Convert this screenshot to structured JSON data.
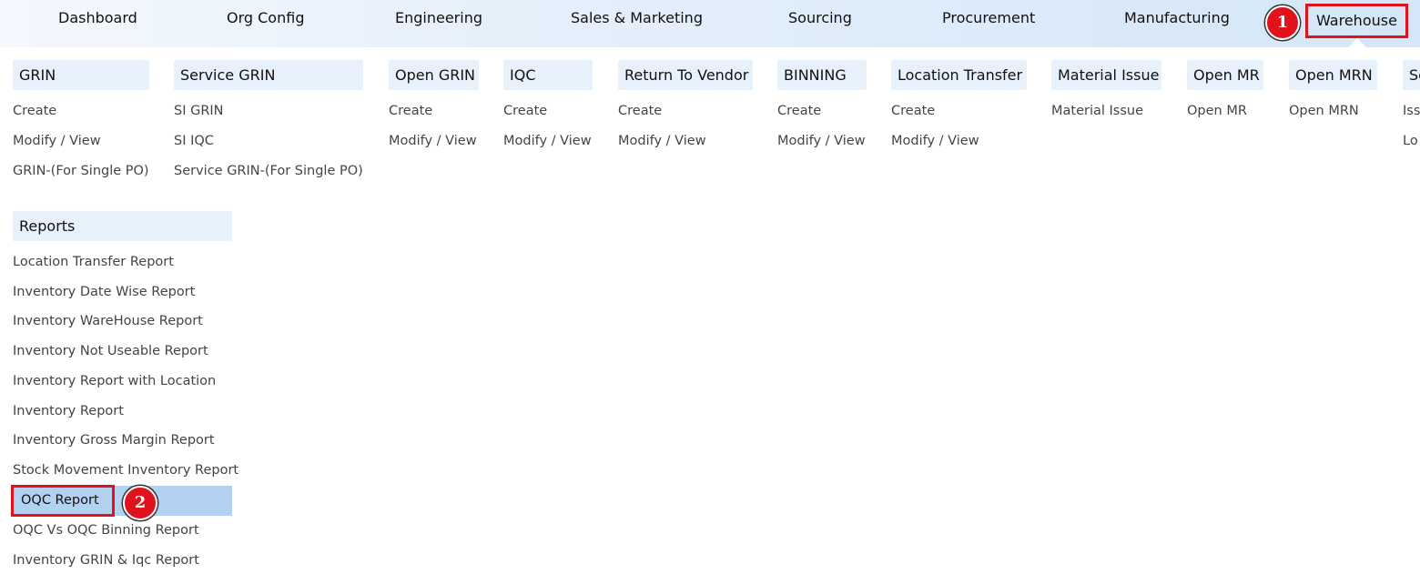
{
  "nav": {
    "items": [
      "Dashboard",
      "Org Config",
      "Engineering",
      "Sales & Marketing",
      "Sourcing",
      "Procurement",
      "Manufacturing"
    ],
    "active": "Warehouse"
  },
  "badges": {
    "one": "1",
    "two": "2"
  },
  "sections": [
    {
      "title": "GRIN",
      "links": [
        "Create",
        "Modify / View",
        "GRIN-(For Single PO)"
      ]
    },
    {
      "title": "Service GRIN",
      "links": [
        "SI GRIN",
        "SI IQC",
        "Service GRIN-(For Single PO)"
      ]
    },
    {
      "title": "Open GRIN",
      "links": [
        "Create",
        "Modify / View"
      ]
    },
    {
      "title": "IQC",
      "links": [
        "Create",
        "Modify / View"
      ]
    },
    {
      "title": "Return To Vendor",
      "links": [
        "Create",
        "Modify / View"
      ]
    },
    {
      "title": "BINNING",
      "links": [
        "Create",
        "Modify / View"
      ]
    },
    {
      "title": "Location Transfer",
      "links": [
        "Create",
        "Modify / View"
      ]
    },
    {
      "title": "Material Issue",
      "links": [
        "Material Issue"
      ]
    },
    {
      "title": "Open MR",
      "links": [
        "Open MR"
      ]
    },
    {
      "title": "Open MRN",
      "links": [
        "Open MRN"
      ]
    },
    {
      "title": "Se",
      "links": [
        "Iss",
        "Lo"
      ]
    }
  ],
  "reports": {
    "title": "Reports",
    "items": [
      "Location Transfer Report",
      "Inventory Date Wise Report",
      "Inventory WareHouse Report",
      "Inventory Not Useable Report",
      "Inventory Report with Location",
      "Inventory Report",
      "Inventory Gross Margin Report",
      "Stock Movement Inventory Report",
      "OQC Report",
      "OQC Vs OQC Binning Report",
      "Inventory GRIN & Iqc Report"
    ]
  },
  "colors": {
    "highlight": "#e0121b",
    "selected_row": "#b3d2f1",
    "section_bg": "#e6f1fb"
  }
}
